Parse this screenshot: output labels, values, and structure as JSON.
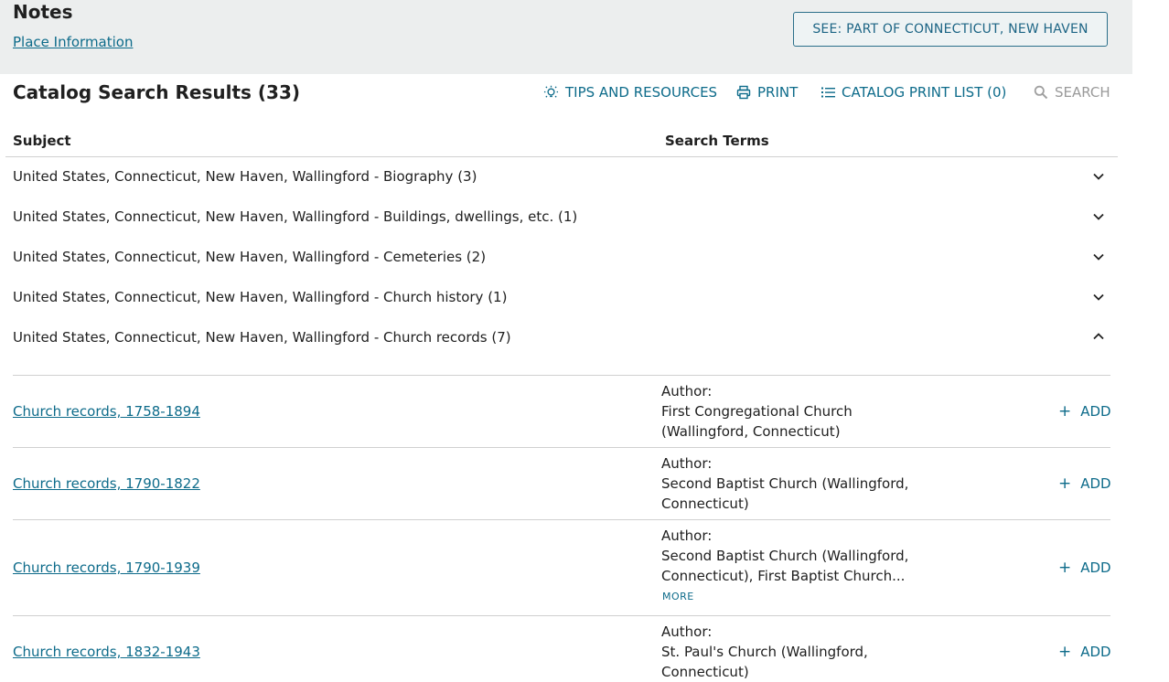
{
  "notes": {
    "title": "Notes",
    "place_info_link": "Place Information",
    "see_part_button": "SEE: PART OF CONNECTICUT, NEW HAVEN"
  },
  "results": {
    "title": "Catalog Search Results (33)",
    "toolbar": {
      "tips": "TIPS AND RESOURCES",
      "print": "PRINT",
      "print_list": "CATALOG PRINT LIST (0)",
      "search": "SEARCH"
    },
    "columns": {
      "subject": "Subject",
      "search_terms": "Search Terms"
    },
    "subjects": [
      {
        "label": "United States, Connecticut, New Haven, Wallingford - Biography (3)",
        "expanded": false
      },
      {
        "label": "United States, Connecticut, New Haven, Wallingford - Buildings, dwellings, etc. (1)",
        "expanded": false
      },
      {
        "label": "United States, Connecticut, New Haven, Wallingford - Cemeteries (2)",
        "expanded": false
      },
      {
        "label": "United States, Connecticut, New Haven, Wallingford - Church history (1)",
        "expanded": false
      },
      {
        "label": "United States, Connecticut, New Haven, Wallingford - Church records (7)",
        "expanded": true
      }
    ],
    "records": [
      {
        "title": "Church records, 1758-1894",
        "author_label": "Author:",
        "author_line1": "First Congregational Church",
        "author_line2": "(Wallingford, Connecticut)",
        "add": "ADD"
      },
      {
        "title": "Church records, 1790-1822",
        "author_label": "Author:",
        "author_line1": "Second Baptist Church (Wallingford,",
        "author_line2": "Connecticut)",
        "add": "ADD"
      },
      {
        "title": "Church records, 1790-1939",
        "author_label": "Author:",
        "author_line1": "Second Baptist Church (Wallingford,",
        "author_line2": "Connecticut), First Baptist Church...",
        "more": "MORE",
        "add": "ADD"
      },
      {
        "title": "Church records, 1832-1943",
        "author_label": "Author:",
        "author_line1": "St. Paul's Church (Wallingford,",
        "author_line2": "Connecticut)",
        "add": "ADD"
      }
    ]
  }
}
